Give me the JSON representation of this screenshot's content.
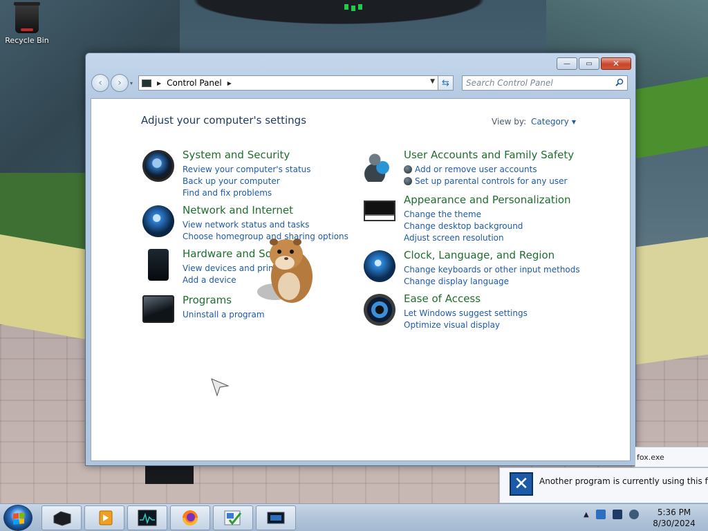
{
  "desktop": {
    "recycle_bin_label": "Recycle Bin"
  },
  "window": {
    "controls": {
      "minimize": "—",
      "maximize": "▭",
      "close": "✕"
    },
    "address": {
      "breadcrumbs": [
        "Control Panel"
      ]
    },
    "search": {
      "placeholder": "Search Control Panel"
    },
    "heading": "Adjust your computer's settings",
    "view_by_label": "View by:",
    "view_by_value": "Category",
    "categories_left": [
      {
        "title": "System and Security",
        "icon": "shield-globe-icon",
        "links": [
          "Review your computer's status",
          "Back up your computer",
          "Find and fix problems"
        ]
      },
      {
        "title": "Network and Internet",
        "icon": "network-globe-icon",
        "links": [
          "View network status and tasks",
          "Choose homegroup and sharing options"
        ]
      },
      {
        "title": "Hardware and Sound",
        "icon": "printer-speaker-icon",
        "links": [
          "View devices and printers",
          "Add a device"
        ]
      },
      {
        "title": "Programs",
        "icon": "programs-box-icon",
        "links": [
          "Uninstall a program"
        ]
      }
    ],
    "categories_right": [
      {
        "title": "User Accounts and Family Safety",
        "icon": "users-icon",
        "links": [
          "Add or remove user accounts",
          "Set up parental controls for any user"
        ]
      },
      {
        "title": "Appearance and Personalization",
        "icon": "monitor-icon",
        "links": [
          "Change the theme",
          "Change desktop background",
          "Adjust screen resolution"
        ]
      },
      {
        "title": "Clock, Language, and Region",
        "icon": "clock-globe-icon",
        "links": [
          "Change keyboards or other input methods",
          "Change display language"
        ]
      },
      {
        "title": "Ease of Access",
        "icon": "ease-of-access-icon",
        "links": [
          "Let Windows suggest settings",
          "Optimize visual display"
        ]
      }
    ]
  },
  "notification": {
    "tab_text": "fox.exe",
    "message": "Another program is currently using this file."
  },
  "taskbar": {
    "buttons": [
      "explorer",
      "media-player",
      "task-manager",
      "firefox",
      "paint-checklist",
      "control-panel"
    ],
    "tray_arrow": "▲",
    "time": "5:36 PM",
    "date": "8/30/2024"
  },
  "colors": {
    "link": "#1e5aa8",
    "category_title": "#1e6f2e",
    "heading": "#1e395b"
  }
}
